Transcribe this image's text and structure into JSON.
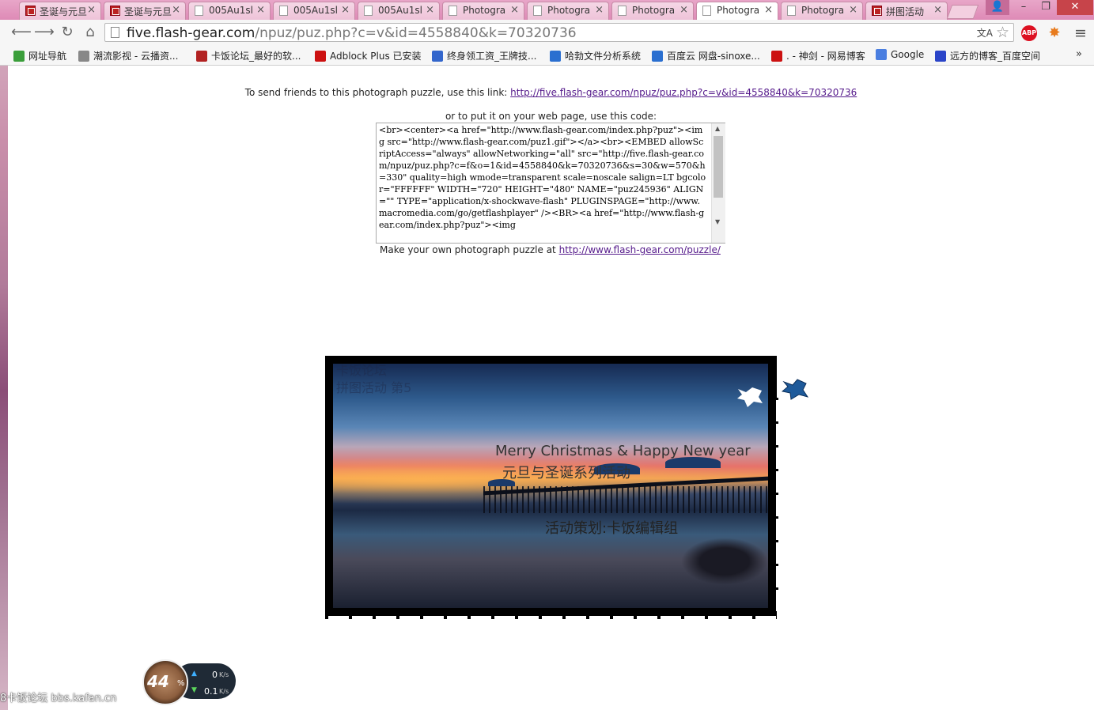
{
  "tabs": [
    {
      "label": "圣诞与元旦",
      "icon": "site-icon",
      "active": false
    },
    {
      "label": "圣诞与元旦",
      "icon": "site-icon",
      "active": false
    },
    {
      "label": "005Au1sl",
      "icon": "page-icon",
      "active": false
    },
    {
      "label": "005Au1sl",
      "icon": "page-icon",
      "active": false
    },
    {
      "label": "005Au1sl",
      "icon": "page-icon",
      "active": false
    },
    {
      "label": "Photogra",
      "icon": "page-icon",
      "active": false
    },
    {
      "label": "Photogra",
      "icon": "page-icon",
      "active": false
    },
    {
      "label": "Photogra",
      "icon": "page-icon",
      "active": false
    },
    {
      "label": "Photogra",
      "icon": "page-icon",
      "active": true
    },
    {
      "label": "Photogra",
      "icon": "page-icon",
      "active": false
    },
    {
      "label": "拼图活动",
      "icon": "site-icon",
      "active": false
    }
  ],
  "window_controls": {
    "minimize": "–",
    "maximize": "❐",
    "close": "✕"
  },
  "address_bar": {
    "url_host": "five.flash-gear.com",
    "url_path": "/npuz/puz.php?c=v&id=4558840&k=70320736"
  },
  "bookmarks": [
    {
      "label": "网址导航",
      "icon": "globe-icon",
      "color": "#3a9e3a"
    },
    {
      "label": "潮流影视 - 云播资...",
      "icon": "film-icon",
      "color": "#888888"
    },
    {
      "label": "卡饭论坛_最好的软...",
      "icon": "kafan-icon",
      "color": "#b22222"
    },
    {
      "label": "Adblock Plus 已安装",
      "icon": "abp-icon",
      "color": "#cc1111"
    },
    {
      "label": "终身领工资_王牌技...",
      "icon": "puzzle-icon",
      "color": "#3366cc"
    },
    {
      "label": "哈勃文件分析系统",
      "icon": "hubble-icon",
      "color": "#2a6fd0"
    },
    {
      "label": "百度云 网盘-sinoxe...",
      "icon": "baidu-cloud-icon",
      "color": "#2a6fd0"
    },
    {
      "label": ". - 神剑 - 网易博客",
      "icon": "netease-icon",
      "color": "#cc1111"
    },
    {
      "label": "Google",
      "icon": "google-icon",
      "color": "#4a7ee0"
    },
    {
      "label": "远方的博客_百度空间",
      "icon": "baidu-paw-icon",
      "color": "#2a44c8"
    }
  ],
  "bookmarks_more": "»",
  "page": {
    "share_text": "To send friends to this photograph puzzle, use this link:",
    "share_link": "http://five.flash-gear.com/npuz/puz.php?c=v&id=4558840&k=70320736",
    "embed_label": "or to put it on your web page, use this code:",
    "embed_code": "<br><center><a href=\"http://www.flash-gear.com/index.php?puz\"><img src=\"http://www.flash-gear.com/puz1.gif\"></a><br><EMBED allowScriptAccess=\"always\" allowNetworking=\"all\" src=\"http://five.flash-gear.com/npuz/puz.php?c=f&o=1&id=4558840&k=70320736&s=30&w=570&h=330\" quality=high wmode=transparent scale=noscale salign=LT bgcolor=\"FFFFFF\" WIDTH=\"720\" HEIGHT=\"480\" NAME=\"puz245936\" ALIGN=\"\" TYPE=\"application/x-shockwave-flash\" PLUGINSPAGE=\"http://www.macromedia.com/go/getflashplayer\" /><BR><a href=\"http://www.flash-gear.com/index.php?puz\"><img",
    "make_own_text": "Make your own photograph puzzle at",
    "make_own_link": "http://www.flash-gear.com/puzzle/"
  },
  "puzzle": {
    "ghost_text_1": "卡饭论坛",
    "ghost_text_2": "拼图活动 第5",
    "line1": "Merry Christmas & Happy New year",
    "line2": "元旦与圣诞系列活动",
    "line3": "活动策划:卡饭编辑组",
    "loose_piece_colors": [
      "#ffffff",
      "#1e5a9a"
    ]
  },
  "speed_widget": {
    "percent": "44",
    "percent_symbol": "%",
    "upload": "0",
    "download": "0.1",
    "unit": "K/s"
  },
  "watermark": "8卡饭论坛 bbs.kafan.cn"
}
